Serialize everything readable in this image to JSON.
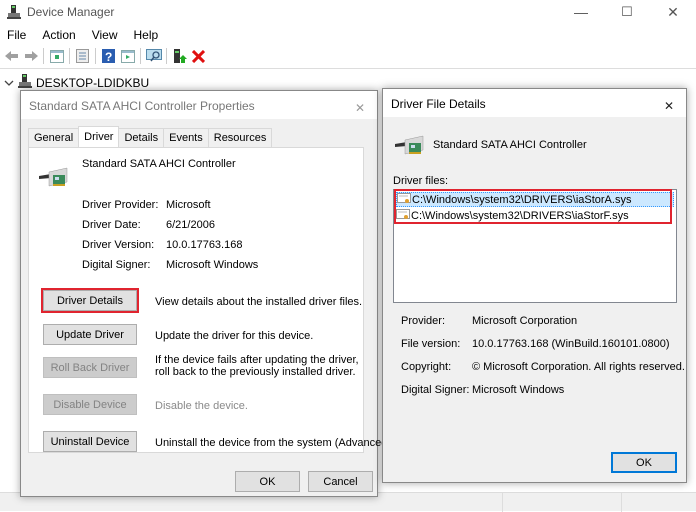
{
  "window": {
    "title": "Device Manager",
    "controls": {
      "minimize": "—",
      "maximize": "☐",
      "close": "✕"
    }
  },
  "menu": [
    "File",
    "Action",
    "View",
    "Help"
  ],
  "toolbar": [
    "back-icon",
    "forward-icon",
    "show-hide-console-tree-icon",
    "properties-icon",
    "help-icon",
    "action-pane-icon",
    "scan-hardware-icon",
    "update-driver-icon",
    "uninstall-icon"
  ],
  "tree": {
    "root": "DESKTOP-LDIDKBU"
  },
  "properties_dialog": {
    "title": "Standard SATA AHCI Controller Properties",
    "close": "✕",
    "tabs": [
      {
        "label": "General",
        "active": false
      },
      {
        "label": "Driver",
        "active": true
      },
      {
        "label": "Details",
        "active": false
      },
      {
        "label": "Events",
        "active": false
      },
      {
        "label": "Resources",
        "active": false
      }
    ],
    "device_name": "Standard SATA AHCI Controller",
    "fields": [
      {
        "label": "Driver Provider:",
        "value": "Microsoft"
      },
      {
        "label": "Driver Date:",
        "value": "6/21/2006"
      },
      {
        "label": "Driver Version:",
        "value": "10.0.17763.168"
      },
      {
        "label": "Digital Signer:",
        "value": "Microsoft Windows"
      }
    ],
    "actions": [
      {
        "button": "Driver Details",
        "description": "View details about the installed driver files.",
        "enabled": true,
        "highlighted": true
      },
      {
        "button": "Update Driver",
        "description": "Update the driver for this device.",
        "enabled": true
      },
      {
        "button": "Roll Back Driver",
        "description": "If the device fails after updating the driver, roll back to the previously installed driver.",
        "enabled": false
      },
      {
        "button": "Disable Device",
        "description": "Disable the device.",
        "enabled": false
      },
      {
        "button": "Uninstall Device",
        "description": "Uninstall the device from the system (Advanced).",
        "enabled": true
      }
    ],
    "ok": "OK",
    "cancel": "Cancel"
  },
  "driver_file_dialog": {
    "title": "Driver File Details",
    "close": "✕",
    "device_name": "Standard SATA AHCI Controller",
    "files_label": "Driver files:",
    "files": [
      "C:\\Windows\\system32\\DRIVERS\\iaStorA.sys",
      "C:\\Windows\\system32\\DRIVERS\\iaStorF.sys"
    ],
    "selected_file_index": 0,
    "fields": [
      {
        "label": "Provider:",
        "value": "Microsoft Corporation"
      },
      {
        "label": "File version:",
        "value": "10.0.17763.168 (WinBuild.160101.0800)"
      },
      {
        "label": "Copyright:",
        "value": "© Microsoft Corporation. All rights reserved."
      },
      {
        "label": "Digital Signer:",
        "value": "Microsoft Windows"
      }
    ],
    "ok": "OK"
  },
  "colors": {
    "highlight": "#e0242f",
    "selection": "#cce8ff",
    "focus": "#0078d7"
  }
}
